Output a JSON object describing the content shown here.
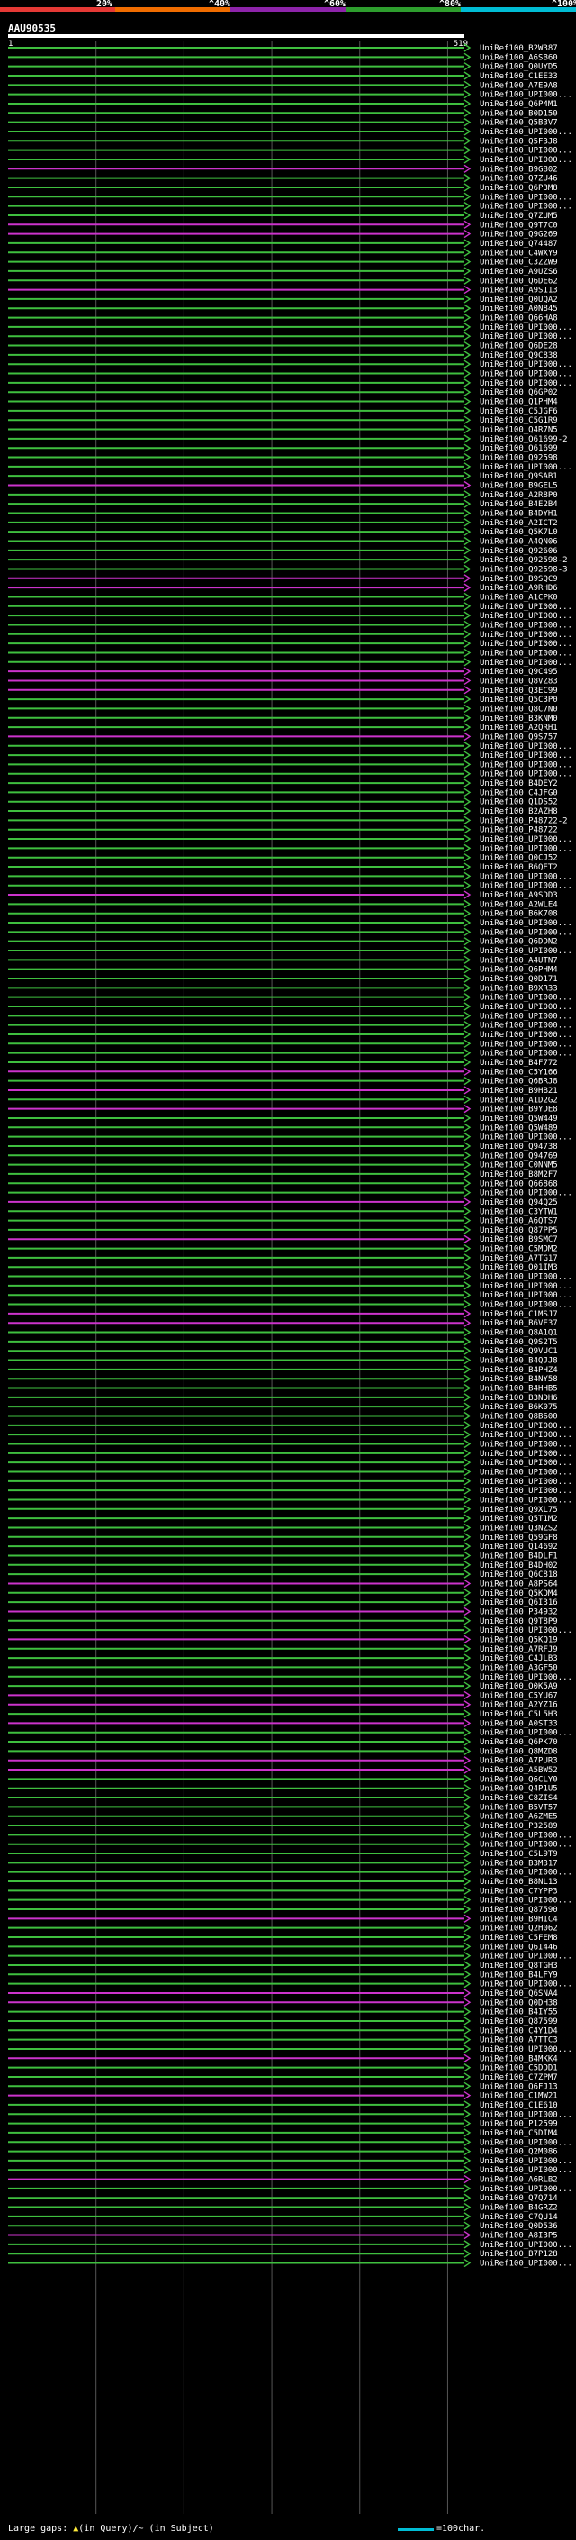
{
  "query_id": "AAU90535",
  "query_start": "1",
  "query_end": "519",
  "identity_scale": {
    "labels": [
      "20%",
      "^40%",
      "^60%",
      "^80%",
      "^100%"
    ],
    "colors": [
      "#e53935",
      "#ef6c00",
      "#8e24aa",
      "#2e9e2e",
      "#00bcd4"
    ]
  },
  "colors": {
    "green": "#3fbf3f",
    "magenta": "#cc33cc",
    "background": "#000000"
  },
  "footer": {
    "gaps_text": "Large gaps: ",
    "gaps_query": "(in Query)",
    "gaps_subject": "/~ (in Subject)",
    "scale_text": "=100char."
  },
  "hits": [
    {
      "id": "UniRef100_B2W387",
      "c": "g"
    },
    {
      "id": "UniRef100_A6SB60",
      "c": "g"
    },
    {
      "id": "UniRef100_Q0UYD5",
      "c": "g"
    },
    {
      "id": "UniRef100_C1EE33",
      "c": "g"
    },
    {
      "id": "UniRef100_A7E9A8",
      "c": "g"
    },
    {
      "id": "UniRef100_UPI000...",
      "c": "g"
    },
    {
      "id": "UniRef100_Q6P4M1",
      "c": "g"
    },
    {
      "id": "UniRef100_B0D150",
      "c": "g"
    },
    {
      "id": "UniRef100_Q5B3V7",
      "c": "g"
    },
    {
      "id": "UniRef100_UPI000...",
      "c": "g"
    },
    {
      "id": "UniRef100_Q5F3J8",
      "c": "g"
    },
    {
      "id": "UniRef100_UPI000...",
      "c": "g"
    },
    {
      "id": "UniRef100_UPI000...",
      "c": "g"
    },
    {
      "id": "UniRef100_B9G802",
      "c": "m"
    },
    {
      "id": "UniRef100_Q7ZU46",
      "c": "g"
    },
    {
      "id": "UniRef100_Q6P3M8",
      "c": "g"
    },
    {
      "id": "UniRef100_UPI000...",
      "c": "g"
    },
    {
      "id": "UniRef100_UPI000...",
      "c": "g"
    },
    {
      "id": "UniRef100_Q7ZUM5",
      "c": "g"
    },
    {
      "id": "UniRef100_Q9T7C0",
      "c": "m"
    },
    {
      "id": "UniRef100_Q9G269",
      "c": "m"
    },
    {
      "id": "UniRef100_Q74487",
      "c": "g"
    },
    {
      "id": "UniRef100_C4WXY9",
      "c": "g"
    },
    {
      "id": "UniRef100_C3ZZW9",
      "c": "g"
    },
    {
      "id": "UniRef100_A9UZS6",
      "c": "g"
    },
    {
      "id": "UniRef100_Q6DE62",
      "c": "g"
    },
    {
      "id": "UniRef100_A9S113",
      "c": "m"
    },
    {
      "id": "UniRef100_Q0UQA2",
      "c": "g"
    },
    {
      "id": "UniRef100_A0N845",
      "c": "g"
    },
    {
      "id": "UniRef100_Q66HA8",
      "g": "g",
      "c": "g"
    },
    {
      "id": "UniRef100_UPI000...",
      "c": "g"
    },
    {
      "id": "UniRef100_UPI000...",
      "c": "g"
    },
    {
      "id": "UniRef100_Q6DE28",
      "c": "g"
    },
    {
      "id": "UniRef100_Q9C838",
      "c": "g"
    },
    {
      "id": "UniRef100_UPI000...",
      "c": "g"
    },
    {
      "id": "UniRef100_UPI000...",
      "c": "g"
    },
    {
      "id": "UniRef100_UPI000...",
      "c": "g"
    },
    {
      "id": "UniRef100_Q6GP02",
      "c": "g"
    },
    {
      "id": "UniRef100_Q1PHM4",
      "c": "g"
    },
    {
      "id": "UniRef100_C5JGF6",
      "c": "g"
    },
    {
      "id": "UniRef100_C5G1R9",
      "c": "g"
    },
    {
      "id": "UniRef100_Q4R7N5",
      "c": "g"
    },
    {
      "id": "UniRef100_Q61699-2",
      "c": "g"
    },
    {
      "id": "UniRef100_Q61699",
      "c": "g"
    },
    {
      "id": "UniRef100_Q92598",
      "c": "g"
    },
    {
      "id": "UniRef100_UPI000...",
      "c": "g"
    },
    {
      "id": "UniRef100_Q9SAB1",
      "c": "g"
    },
    {
      "id": "UniRef100_B9GEL5",
      "c": "m"
    },
    {
      "id": "UniRef100_A2R8P0",
      "c": "g"
    },
    {
      "id": "UniRef100_B4E2B4",
      "c": "g"
    },
    {
      "id": "UniRef100_B4DYH1",
      "c": "g"
    },
    {
      "id": "UniRef100_A2ICT2",
      "c": "g"
    },
    {
      "id": "UniRef100_Q5K7L0",
      "c": "g"
    },
    {
      "id": "UniRef100_A4QN06",
      "c": "g"
    },
    {
      "id": "UniRef100_Q92606",
      "c": "g"
    },
    {
      "id": "UniRef100_Q92598-2",
      "c": "g"
    },
    {
      "id": "UniRef100_Q92598-3",
      "c": "g"
    },
    {
      "id": "UniRef100_B9SQC9",
      "c": "m"
    },
    {
      "id": "UniRef100_A9RHD6",
      "c": "m"
    },
    {
      "id": "UniRef100_A1CPK0",
      "c": "g"
    },
    {
      "id": "UniRef100_UPI000...",
      "c": "g"
    },
    {
      "id": "UniRef100_UPI000...",
      "c": "g"
    },
    {
      "id": "UniRef100_UPI000...",
      "c": "g"
    },
    {
      "id": "UniRef100_UPI000...",
      "c": "g"
    },
    {
      "id": "UniRef100_UPI000...",
      "c": "g"
    },
    {
      "id": "UniRef100_UPI000...",
      "c": "g"
    },
    {
      "id": "UniRef100_UPI000...",
      "c": "g"
    },
    {
      "id": "UniRef100_Q9C495",
      "c": "m"
    },
    {
      "id": "UniRef100_Q8VZ83",
      "c": "m"
    },
    {
      "id": "UniRef100_Q3EC99",
      "c": "m"
    },
    {
      "id": "UniRef100_Q5C3P0",
      "c": "g"
    },
    {
      "id": "UniRef100_Q8C7N0",
      "c": "g"
    },
    {
      "id": "UniRef100_B3KNM0",
      "c": "g"
    },
    {
      "id": "UniRef100_A2QRH1",
      "c": "g"
    },
    {
      "id": "UniRef100_Q9S757",
      "c": "m"
    },
    {
      "id": "UniRef100_UPI000...",
      "c": "g"
    },
    {
      "id": "UniRef100_UPI000...",
      "c": "g"
    },
    {
      "id": "UniRef100_UPI000...",
      "c": "g"
    },
    {
      "id": "UniRef100_UPI000...",
      "c": "g"
    },
    {
      "id": "UniRef100_B4DEY2",
      "c": "g"
    },
    {
      "id": "UniRef100_C4JFG0",
      "c": "g"
    },
    {
      "id": "UniRef100_Q1DS52",
      "c": "g"
    },
    {
      "id": "UniRef100_B2AZH8",
      "c": "g"
    },
    {
      "id": "UniRef100_P48722-2",
      "c": "g"
    },
    {
      "id": "UniRef100_P48722",
      "c": "g"
    },
    {
      "id": "UniRef100_UPI000...",
      "c": "g"
    },
    {
      "id": "UniRef100_UPI000...",
      "c": "g"
    },
    {
      "id": "UniRef100_Q0CJ52",
      "c": "g"
    },
    {
      "id": "UniRef100_B6QET2",
      "c": "g"
    },
    {
      "id": "UniRef100_UPI000...",
      "c": "g"
    },
    {
      "id": "UniRef100_UPI000...",
      "c": "g"
    },
    {
      "id": "UniRef100_A9SDD3",
      "c": "m"
    },
    {
      "id": "UniRef100_A2WLE4",
      "c": "g"
    },
    {
      "id": "UniRef100_B6K708",
      "c": "g"
    },
    {
      "id": "UniRef100_UPI000...",
      "c": "g"
    },
    {
      "id": "UniRef100_UPI000...",
      "c": "g"
    },
    {
      "id": "UniRef100_Q6DDN2",
      "c": "g"
    },
    {
      "id": "UniRef100_UPI000...",
      "c": "g"
    },
    {
      "id": "UniRef100_A4UTN7",
      "c": "g"
    },
    {
      "id": "UniRef100_Q6PHM4",
      "c": "g"
    },
    {
      "id": "UniRef100_Q0D171",
      "c": "g"
    },
    {
      "id": "UniRef100_B9XR33",
      "c": "g"
    },
    {
      "id": "UniRef100_UPI000...",
      "c": "g"
    },
    {
      "id": "UniRef100_UPI000...",
      "c": "g"
    },
    {
      "id": "UniRef100_UPI000...",
      "c": "g"
    },
    {
      "id": "UniRef100_UPI000...",
      "c": "g"
    },
    {
      "id": "UniRef100_UPI000...",
      "c": "g"
    },
    {
      "id": "UniRef100_UPI000...",
      "c": "g"
    },
    {
      "id": "UniRef100_UPI000...",
      "c": "g"
    },
    {
      "id": "UniRef100_B4F772",
      "c": "g"
    },
    {
      "id": "UniRef100_C5Y166",
      "c": "m"
    },
    {
      "id": "UniRef100_Q6BRJ8",
      "c": "g"
    },
    {
      "id": "UniRef100_B9HB21",
      "c": "m"
    },
    {
      "id": "UniRef100_A1D2G2",
      "c": "g"
    },
    {
      "id": "UniRef100_B9YDE8",
      "c": "m"
    },
    {
      "id": "UniRef100_Q5W449",
      "c": "g"
    },
    {
      "id": "UniRef100_Q5W489",
      "c": "g"
    },
    {
      "id": "UniRef100_UPI000...",
      "c": "g"
    },
    {
      "id": "UniRef100_Q94738",
      "c": "g"
    },
    {
      "id": "UniRef100_Q94769",
      "c": "g"
    },
    {
      "id": "UniRef100_C0NNM5",
      "c": "g"
    },
    {
      "id": "UniRef100_B8M2F7",
      "c": "g"
    },
    {
      "id": "UniRef100_Q66868",
      "c": "g"
    },
    {
      "id": "UniRef100_UPI000...",
      "c": "g"
    },
    {
      "id": "UniRef100_Q94Q25",
      "c": "m"
    },
    {
      "id": "UniRef100_C3YTW1",
      "c": "g"
    },
    {
      "id": "UniRef100_A6QTS7",
      "c": "g"
    },
    {
      "id": "UniRef100_Q87PP5",
      "c": "g"
    },
    {
      "id": "UniRef100_B9SMC7",
      "c": "m"
    },
    {
      "id": "UniRef100_C5MDM2",
      "c": "g"
    },
    {
      "id": "UniRef100_A7TG17",
      "c": "g"
    },
    {
      "id": "UniRef100_Q01IM3",
      "c": "g"
    },
    {
      "id": "UniRef100_UPI000...",
      "c": "g"
    },
    {
      "id": "UniRef100_UPI000...",
      "c": "g"
    },
    {
      "id": "UniRef100_UPI000...",
      "c": "g"
    },
    {
      "id": "UniRef100_UPI000...",
      "c": "g"
    },
    {
      "id": "UniRef100_C1MSJ7",
      "c": "m"
    },
    {
      "id": "UniRef100_B6VE37",
      "c": "m"
    },
    {
      "id": "UniRef100_Q8A1Q1",
      "c": "g"
    },
    {
      "id": "UniRef100_Q9S2T5",
      "c": "g"
    },
    {
      "id": "UniRef100_Q9VUC1",
      "c": "g"
    },
    {
      "id": "UniRef100_B4QJJ8",
      "c": "g"
    },
    {
      "id": "UniRef100_B4PHZ4",
      "c": "g"
    },
    {
      "id": "UniRef100_B4NY58",
      "c": "g"
    },
    {
      "id": "UniRef100_B4HHB5",
      "c": "g"
    },
    {
      "id": "UniRef100_B3NDH6",
      "c": "g"
    },
    {
      "id": "UniRef100_B6K075",
      "c": "g"
    },
    {
      "id": "UniRef100_Q8B600",
      "c": "g"
    },
    {
      "id": "UniRef100_UPI000...",
      "c": "g"
    },
    {
      "id": "UniRef100_UPI000...",
      "c": "g"
    },
    {
      "id": "UniRef100_UPI000...",
      "c": "g"
    },
    {
      "id": "UniRef100_UPI000...",
      "c": "g"
    },
    {
      "id": "UniRef100_UPI000...",
      "c": "g"
    },
    {
      "id": "UniRef100_UPI000...",
      "c": "g"
    },
    {
      "id": "UniRef100_UPI000...",
      "c": "g"
    },
    {
      "id": "UniRef100_UPI000...",
      "c": "g"
    },
    {
      "id": "UniRef100_UPI000...",
      "c": "g"
    },
    {
      "id": "UniRef100_Q9XL75",
      "c": "g"
    },
    {
      "id": "UniRef100_Q5T1M2",
      "c": "g"
    },
    {
      "id": "UniRef100_Q3NZS2",
      "c": "g"
    },
    {
      "id": "UniRef100_Q59GF8",
      "c": "g"
    },
    {
      "id": "UniRef100_Q14692",
      "c": "g"
    },
    {
      "id": "UniRef100_B4DLF1",
      "c": "g"
    },
    {
      "id": "UniRef100_B4DH02",
      "c": "g"
    },
    {
      "id": "UniRef100_Q6C818",
      "c": "g"
    },
    {
      "id": "UniRef100_A8PS64",
      "c": "m"
    },
    {
      "id": "UniRef100_Q5KDM4",
      "c": "g"
    },
    {
      "id": "UniRef100_Q6I316",
      "c": "g"
    },
    {
      "id": "UniRef100_P34932",
      "c": "m"
    },
    {
      "id": "UniRef100_Q9T8P9",
      "c": "g"
    },
    {
      "id": "UniRef100_UPI000...",
      "c": "g"
    },
    {
      "id": "UniRef100_Q5KQ19",
      "c": "m"
    },
    {
      "id": "UniRef100_A7RFJ9",
      "c": "g"
    },
    {
      "id": "UniRef100_C4JLB3",
      "c": "g"
    },
    {
      "id": "UniRef100_A3GF50",
      "c": "g"
    },
    {
      "id": "UniRef100_UPI000...",
      "c": "g"
    },
    {
      "id": "UniRef100_Q0K5A9",
      "c": "g"
    },
    {
      "id": "UniRef100_C5YU67",
      "c": "m"
    },
    {
      "id": "UniRef100_A2YZ16",
      "c": "m"
    },
    {
      "id": "UniRef100_C5L5H3",
      "c": "g"
    },
    {
      "id": "UniRef100_A0ST33",
      "c": "m"
    },
    {
      "id": "UniRef100_UPI000...",
      "c": "g"
    },
    {
      "id": "UniRef100_Q6PK70",
      "c": "g"
    },
    {
      "id": "UniRef100_Q8MZD8",
      "c": "g"
    },
    {
      "id": "UniRef100_A7PUR3",
      "c": "m"
    },
    {
      "id": "UniRef100_A5BW52",
      "c": "m"
    },
    {
      "id": "UniRef100_Q6CLY0",
      "c": "g"
    },
    {
      "id": "UniRef100_Q4P1U5",
      "c": "g"
    },
    {
      "id": "UniRef100_C8ZIS4",
      "c": "g"
    },
    {
      "id": "UniRef100_B5VT57",
      "c": "g"
    },
    {
      "id": "UniRef100_A6ZME5",
      "c": "g"
    },
    {
      "id": "UniRef100_P32589",
      "c": "g"
    },
    {
      "id": "UniRef100_UPI000...",
      "c": "g"
    },
    {
      "id": "UniRef100_UPI000...",
      "c": "g"
    },
    {
      "id": "UniRef100_C5L9T9",
      "c": "g"
    },
    {
      "id": "UniRef100_B3M317",
      "c": "g"
    },
    {
      "id": "UniRef100_UPI000...",
      "c": "g"
    },
    {
      "id": "UniRef100_B8NL13",
      "c": "g"
    },
    {
      "id": "UniRef100_C7YPP3",
      "c": "g"
    },
    {
      "id": "UniRef100_UPI000...",
      "c": "g"
    },
    {
      "id": "UniRef100_Q87590",
      "c": "g"
    },
    {
      "id": "UniRef100_B9HIC4",
      "c": "m"
    },
    {
      "id": "UniRef100_Q2H062",
      "c": "g"
    },
    {
      "id": "UniRef100_C5FEM8",
      "c": "g"
    },
    {
      "id": "UniRef100_Q6I446",
      "c": "g"
    },
    {
      "id": "UniRef100_UPI000...",
      "c": "g"
    },
    {
      "id": "UniRef100_Q8TGH3",
      "c": "g"
    },
    {
      "id": "UniRef100_B4LFY9",
      "c": "g"
    },
    {
      "id": "UniRef100_UPI000...",
      "c": "g"
    },
    {
      "id": "UniRef100_Q6SNA4",
      "c": "m"
    },
    {
      "id": "UniRef100_Q0DH38",
      "c": "m"
    },
    {
      "id": "UniRef100_B4IY55",
      "c": "g"
    },
    {
      "id": "UniRef100_Q87599",
      "c": "g"
    },
    {
      "id": "UniRef100_C4Y1D4",
      "c": "g"
    },
    {
      "id": "UniRef100_A7TTC3",
      "c": "g"
    },
    {
      "id": "UniRef100_UPI000...",
      "c": "g"
    },
    {
      "id": "UniRef100_B4MKK4",
      "c": "m"
    },
    {
      "id": "UniRef100_C5DDD1",
      "c": "g"
    },
    {
      "id": "UniRef100_C7ZPM7",
      "c": "g"
    },
    {
      "id": "UniRef100_Q6FJ13",
      "c": "g"
    },
    {
      "id": "UniRef100_C1MW21",
      "c": "m"
    },
    {
      "id": "UniRef100_C1E610",
      "c": "g"
    },
    {
      "id": "UniRef100_UPI000...",
      "c": "g"
    },
    {
      "id": "UniRef100_P12599",
      "c": "g"
    },
    {
      "id": "UniRef100_C5DIM4",
      "c": "g"
    },
    {
      "id": "UniRef100_UPI000...",
      "c": "g"
    },
    {
      "id": "UniRef100_Q2M086",
      "c": "g"
    },
    {
      "id": "UniRef100_UPI000...",
      "c": "g"
    },
    {
      "id": "UniRef100_UPI000...",
      "c": "g"
    },
    {
      "id": "UniRef100_A6RLB2",
      "c": "m"
    },
    {
      "id": "UniRef100_UPI000...",
      "c": "g"
    },
    {
      "id": "UniRef100_Q7Q714",
      "c": "g"
    },
    {
      "id": "UniRef100_B4GRZ2",
      "c": "g"
    },
    {
      "id": "UniRef100_C7QU14",
      "c": "g"
    },
    {
      "id": "UniRef100_Q0D536",
      "c": "g"
    },
    {
      "id": "UniRef100_A8I3P5",
      "c": "m"
    },
    {
      "id": "UniRef100_UPI000...",
      "c": "g"
    },
    {
      "id": "UniRef100_B7P128",
      "c": "g"
    },
    {
      "id": "UniRef100_UPI000...",
      "c": "g"
    }
  ]
}
